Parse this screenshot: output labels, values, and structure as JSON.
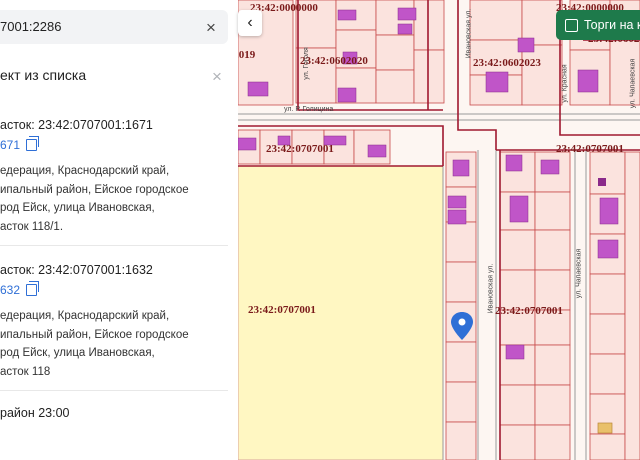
{
  "search": {
    "value": "7001:2286"
  },
  "list": {
    "heading": "ект из списка",
    "items": [
      {
        "title": "асток: 23:42:0707001:1671",
        "number": "671",
        "address": [
          "едерация, Краснодарский край,",
          "ипальный район, Ейское городское",
          "род Ейск, улица Ивановская,",
          "асток 118/1."
        ]
      },
      {
        "title": "асток: 23:42:0707001:1632",
        "number": "632",
        "address": [
          "едерация, Краснодарский край,",
          "ипальный район, Ейское городское",
          "род Ейск, улица Ивановская,",
          "асток 118"
        ]
      }
    ],
    "bottom_text": "район 23:00"
  },
  "map": {
    "back_label": "‹",
    "torgi_label": "Торги на карте",
    "labels": [
      "23:42:0000000",
      "23:42:0602020",
      "23:42:0602023",
      "23:42:0707001",
      "23:42:0707001",
      "23:42:0707001",
      "23:42:0707001",
      ".019",
      "23:42:0000000",
      "23:42:0602"
    ],
    "streets": [
      "ул. Р. Голицина",
      "ул. Гоголя",
      "Ивановская ул.",
      "ул. Красная",
      "ул. Чапаевская",
      "Ивановская ул.",
      "ул. Чапаевская"
    ],
    "colors": {
      "parcel_fill": "#fbe3de",
      "parcel_line": "#c84a4a",
      "building": "#c055c8",
      "district_line": "#a01830",
      "land": "#fff7c2",
      "torgi": "#1e7a4b",
      "pin": "#2f6fd6"
    }
  },
  "icons": {
    "close": "×",
    "copy": "copy-icon",
    "pin": "location-pin-icon",
    "back": "chevron-left-icon",
    "checkbox": "checkbox-icon"
  }
}
